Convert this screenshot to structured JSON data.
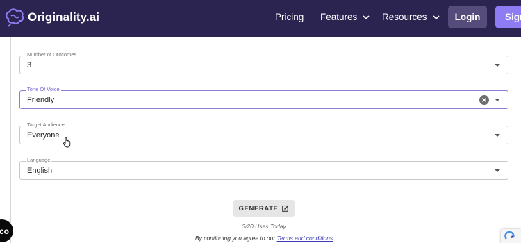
{
  "header": {
    "brand": "Originality.ai",
    "nav": [
      {
        "label": "Pricing"
      },
      {
        "label": "Features"
      },
      {
        "label": "Resources"
      }
    ],
    "login_label": "Login",
    "sign_label": "Sign"
  },
  "form": {
    "fields": [
      {
        "label": "Number of Outcomes",
        "value": "3"
      },
      {
        "label": "Tone Of Voice",
        "value": "Friendly"
      },
      {
        "label": "Target Audience",
        "value": "Everyone"
      },
      {
        "label": "Language",
        "value": "English"
      }
    ],
    "generate_label": "GENERATE",
    "uses_text": "3/20 Uses Today",
    "terms_prefix": "By continuing you agree to our ",
    "terms_link": "Terms and conditions"
  },
  "chat_bubble_text": "co",
  "colors": {
    "header_bg": "#2b2350",
    "login_bg": "#564c7b",
    "sign_bg": "#8e7cf5",
    "active_border": "#8a7fd6"
  }
}
